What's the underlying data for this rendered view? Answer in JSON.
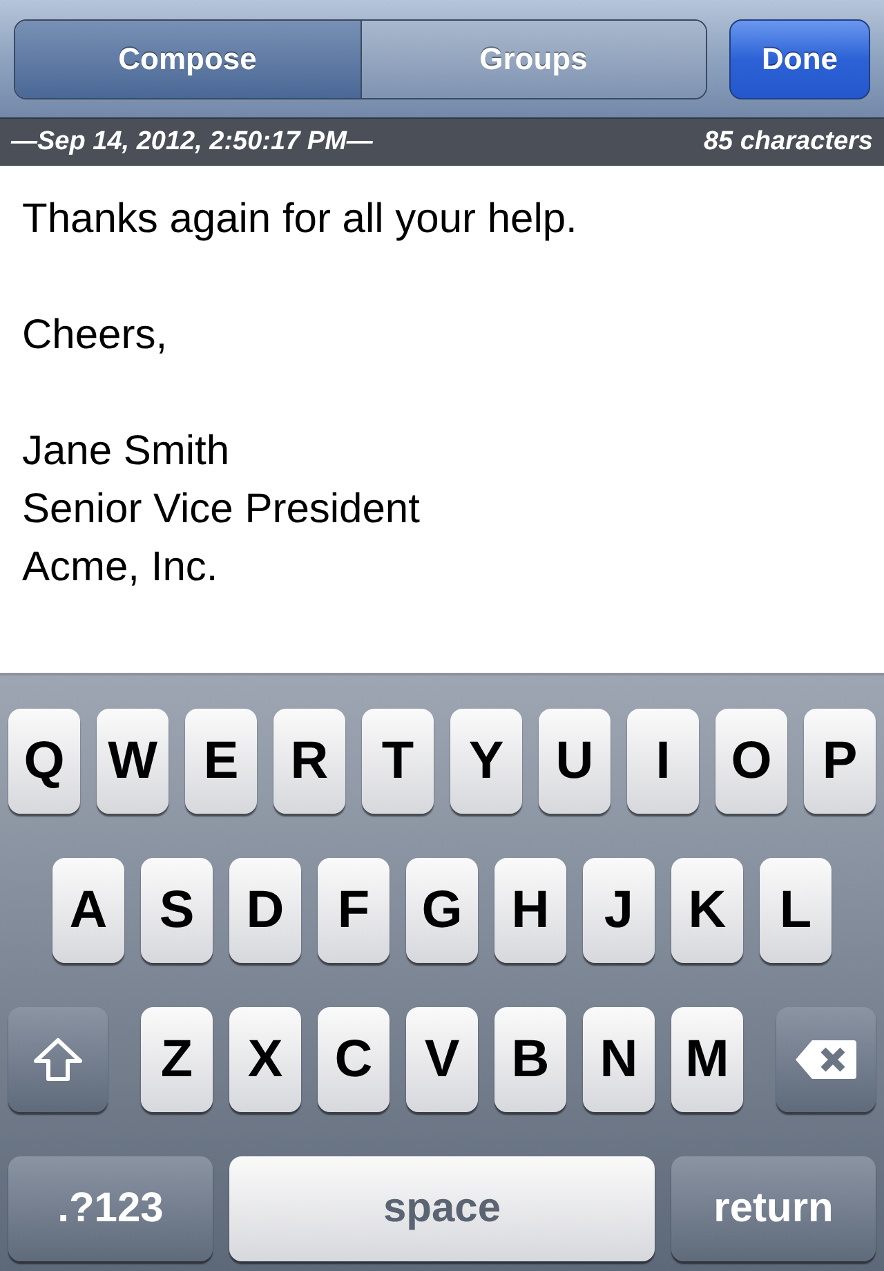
{
  "nav_bar": {
    "segments": [
      {
        "label": "Compose",
        "selected": true
      },
      {
        "label": "Groups",
        "selected": false
      }
    ],
    "done_button": "Done"
  },
  "info_bar": {
    "timestamp": "—Sep 14, 2012, 2:50:17 PM—",
    "character_count": "85 characters"
  },
  "message": {
    "paragraphs": [
      [
        "Thanks again for all your help."
      ],
      [
        "Cheers,"
      ],
      [
        "Jane Smith",
        "Senior Vice President",
        "Acme, Inc."
      ]
    ]
  },
  "keyboard": {
    "rows": [
      [
        {
          "kind": "letter",
          "label": "Q"
        },
        {
          "kind": "letter",
          "label": "W"
        },
        {
          "kind": "letter",
          "label": "E"
        },
        {
          "kind": "letter",
          "label": "R"
        },
        {
          "kind": "letter",
          "label": "T"
        },
        {
          "kind": "letter",
          "label": "Y"
        },
        {
          "kind": "letter",
          "label": "U"
        },
        {
          "kind": "letter",
          "label": "I"
        },
        {
          "kind": "letter",
          "label": "O"
        },
        {
          "kind": "letter",
          "label": "P"
        }
      ],
      [
        {
          "kind": "letter",
          "label": "A"
        },
        {
          "kind": "letter",
          "label": "S"
        },
        {
          "kind": "letter",
          "label": "D"
        },
        {
          "kind": "letter",
          "label": "F"
        },
        {
          "kind": "letter",
          "label": "G"
        },
        {
          "kind": "letter",
          "label": "H"
        },
        {
          "kind": "letter",
          "label": "J"
        },
        {
          "kind": "letter",
          "label": "K"
        },
        {
          "kind": "letter",
          "label": "L"
        }
      ],
      [
        {
          "kind": "shift"
        },
        {
          "kind": "letter",
          "label": "Z"
        },
        {
          "kind": "letter",
          "label": "X"
        },
        {
          "kind": "letter",
          "label": "C"
        },
        {
          "kind": "letter",
          "label": "V"
        },
        {
          "kind": "letter",
          "label": "B"
        },
        {
          "kind": "letter",
          "label": "N"
        },
        {
          "kind": "letter",
          "label": "M"
        },
        {
          "kind": "delete"
        }
      ]
    ],
    "bottom_bar": [
      {
        "kind": "mode",
        "label": ".?123"
      },
      {
        "kind": "space",
        "label": "space"
      },
      {
        "kind": "return",
        "label": "return"
      }
    ]
  }
}
